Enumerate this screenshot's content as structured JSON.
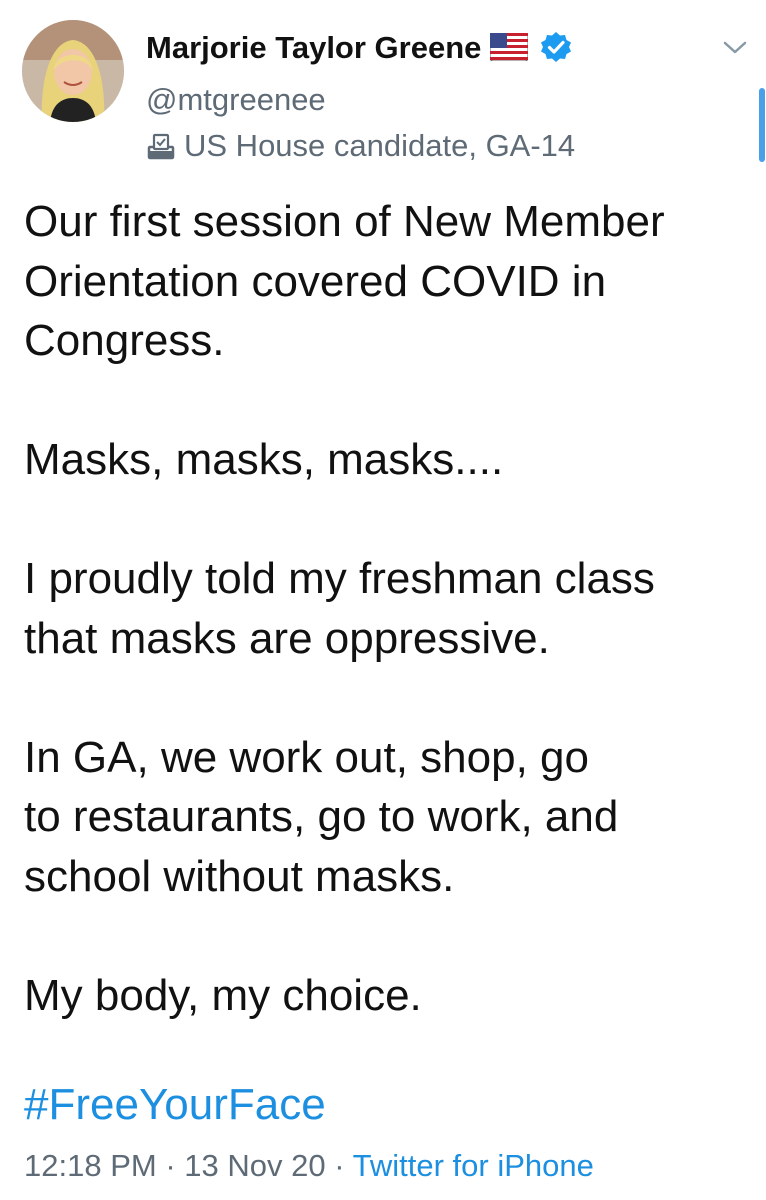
{
  "tweet": {
    "author": {
      "display_name": "Marjorie Taylor Greene",
      "handle": "@mtgreenee",
      "label": "US House candidate, GA-14",
      "badges": [
        "us-flag-icon",
        "verified-icon"
      ]
    },
    "paragraphs": [
      [
        "Our first session of New Member",
        "Orientation covered COVID in",
        "Congress."
      ],
      [
        "Masks, masks, masks...."
      ],
      [
        "I proudly told my freshman class",
        "that masks are oppressive."
      ],
      [
        "In GA, we work out, shop, go",
        "to restaurants, go to work, and",
        "school without masks."
      ],
      [
        "My body, my choice."
      ]
    ],
    "hashtag": "#FreeYourFace",
    "time": "12:18 PM",
    "separator": "·",
    "date": "13 Nov 20",
    "source": "Twitter for iPhone"
  },
  "colors": {
    "link": "#1d8fe0",
    "secondary_text": "#5e6b76",
    "verified": "#1d9bf0"
  }
}
